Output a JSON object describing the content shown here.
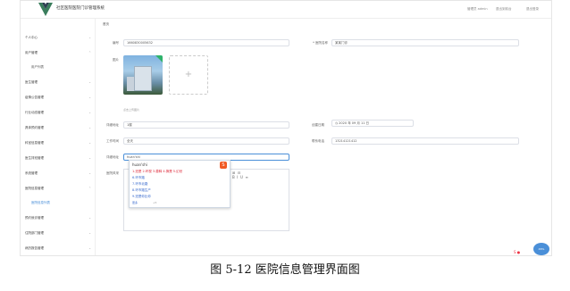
{
  "header": {
    "app_title": "社区医院医院门诊管理系统",
    "links": [
      "管理员 admin",
      "退出到前台",
      "退出登录"
    ]
  },
  "breadcrumb": "首页",
  "sidebar": {
    "items": [
      {
        "label": "个人中心",
        "arrow": "⌄"
      },
      {
        "label": "用户管理",
        "arrow": "⌃"
      },
      {
        "label": "用户列表",
        "sub": true
      },
      {
        "label": "医生管理",
        "arrow": "⌄"
      },
      {
        "label": "疫情公告管理",
        "arrow": "⌄"
      },
      {
        "label": "行业动态管理",
        "arrow": "⌄"
      },
      {
        "label": "具体预约管理",
        "arrow": "⌄"
      },
      {
        "label": "科室信息管理",
        "arrow": "⌄"
      },
      {
        "label": "医生排班管理",
        "arrow": "⌄"
      },
      {
        "label": "系统管理",
        "arrow": "⌄"
      },
      {
        "label": "医院信息管理",
        "arrow": "⌃"
      },
      {
        "label": "医院信息列表",
        "sub": true,
        "active": true
      },
      {
        "label": "预约就诊管理",
        "arrow": "⌄"
      },
      {
        "label": "住院部门管理",
        "arrow": "⌄"
      },
      {
        "label": "病历报告管理",
        "arrow": "⌄"
      }
    ]
  },
  "form": {
    "code_label": "编号",
    "code_value": "1660830005632",
    "name_label": "* 医院名称",
    "name_value": "某某门诊",
    "photo_label": "图片",
    "upload_plus": "+",
    "upload_hint": "点击上传图片",
    "address_label": "详细地址",
    "address_value": "1楼",
    "created_label": "创建日期",
    "created_value": "2020 年 09 月 11 日",
    "calendar_icon": "calendar-icon",
    "hours_label": "工作时间",
    "hours_value": "全天",
    "phone_label": "联系电话",
    "phone_value": "13214121412",
    "intro_label": "详细地址",
    "intro_value": "huan'shi",
    "desc_label": "医院风采"
  },
  "ime": {
    "pinyin": "huan'shi",
    "logo": "S",
    "candidates": [
      "1.还是  2.环视  3.患释  4.换是  5.幻世",
      "6.环市路",
      "7.环市北路",
      "8.环市路生产",
      "9.还是你比你"
    ],
    "footer_left": "更多",
    "footer_right": "+5"
  },
  "editor": {
    "toolbar": "⊞  ⊟\nB  I  U  ≡"
  },
  "tray": {
    "float_ball": "46%",
    "icons": "S ●"
  },
  "caption": "图 5-12 医院信息管理界面图"
}
